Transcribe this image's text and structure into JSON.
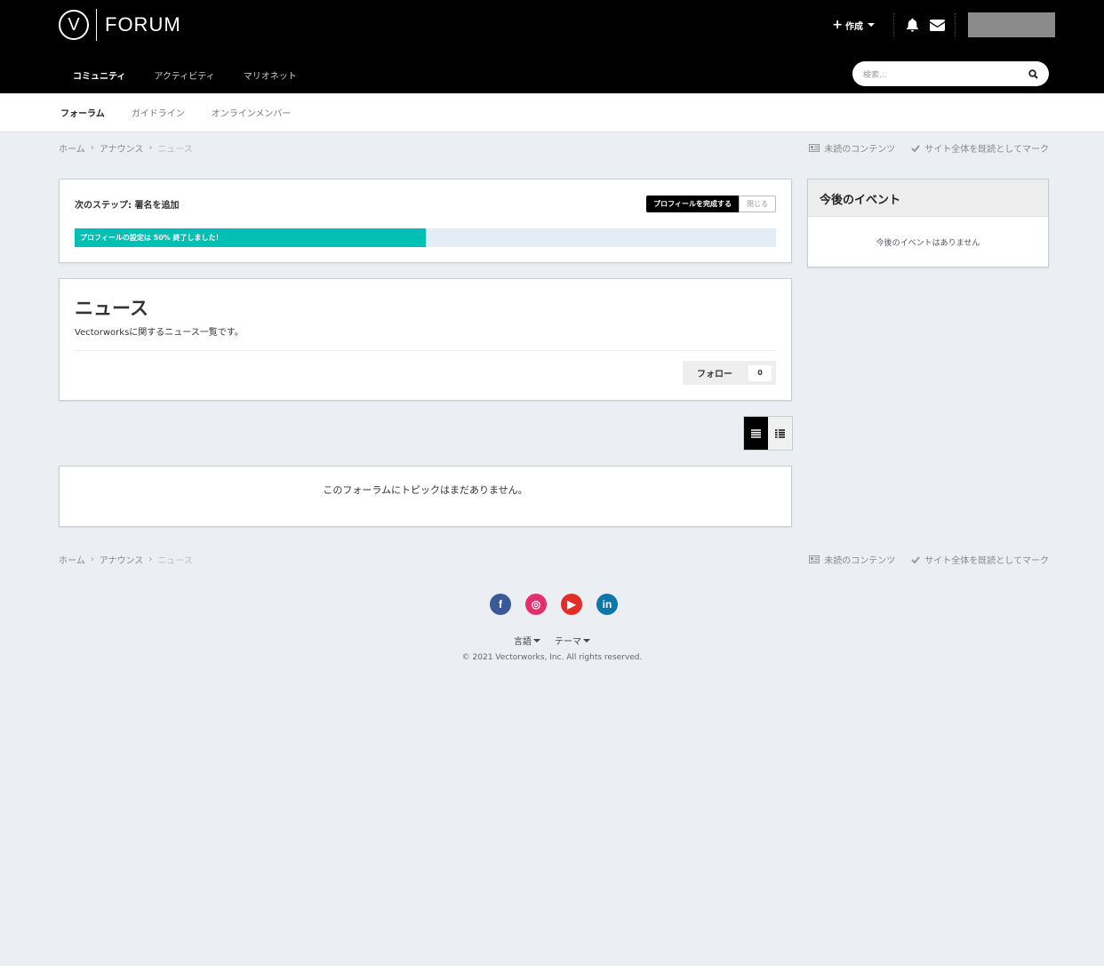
{
  "header": {
    "logo_text": "FORUM",
    "logo_letter": "V",
    "create_label": "作成",
    "main_nav": [
      {
        "label": "コミュニティ"
      },
      {
        "label": "アクティビティ"
      },
      {
        "label": "マリオネット"
      }
    ],
    "search_placeholder": "検索..."
  },
  "subnav": [
    {
      "label": "フォーラム"
    },
    {
      "label": "ガイドライン"
    },
    {
      "label": "オンラインメンバー"
    }
  ],
  "breadcrumb": {
    "items": [
      "ホーム",
      "アナウンス",
      "ニュース"
    ],
    "unread_label": "未読のコンテンツ",
    "mark_read_label": "サイト全体を既読としてマーク"
  },
  "next_step": {
    "title": "次のステップ: 署名を追加",
    "complete_button": "プロフィールを完成する",
    "close_button": "閉じる",
    "progress_label": "プロフィールの設定は 50% 終了しました！",
    "progress_value": 0.5
  },
  "forum": {
    "title": "ニュース",
    "description": "Vectorworksに関するニュース一覧です。",
    "follow_label": "フォロー",
    "follow_count": "0",
    "empty_message": "このフォーラムにトピックはまだありません。"
  },
  "sidebar": {
    "events_title": "今後のイベント",
    "events_empty": "今後のイベントはありません"
  },
  "footer": {
    "social": [
      {
        "name": "facebook-icon",
        "glyph": "f",
        "color": "#3b5998"
      },
      {
        "name": "instagram-icon",
        "glyph": "◎",
        "color": "#e1306c"
      },
      {
        "name": "youtube-icon",
        "glyph": "▶",
        "color": "#e52d27"
      },
      {
        "name": "linkedin-icon",
        "glyph": "in",
        "color": "#0e76a8"
      }
    ],
    "language_label": "言語",
    "theme_label": "テーマ",
    "copyright": "© 2021 Vectorworks, Inc. All rights reserved."
  },
  "colors": {
    "accent": "#00bfb3",
    "header_bg": "#000000",
    "page_bg": "#ebeef2"
  }
}
